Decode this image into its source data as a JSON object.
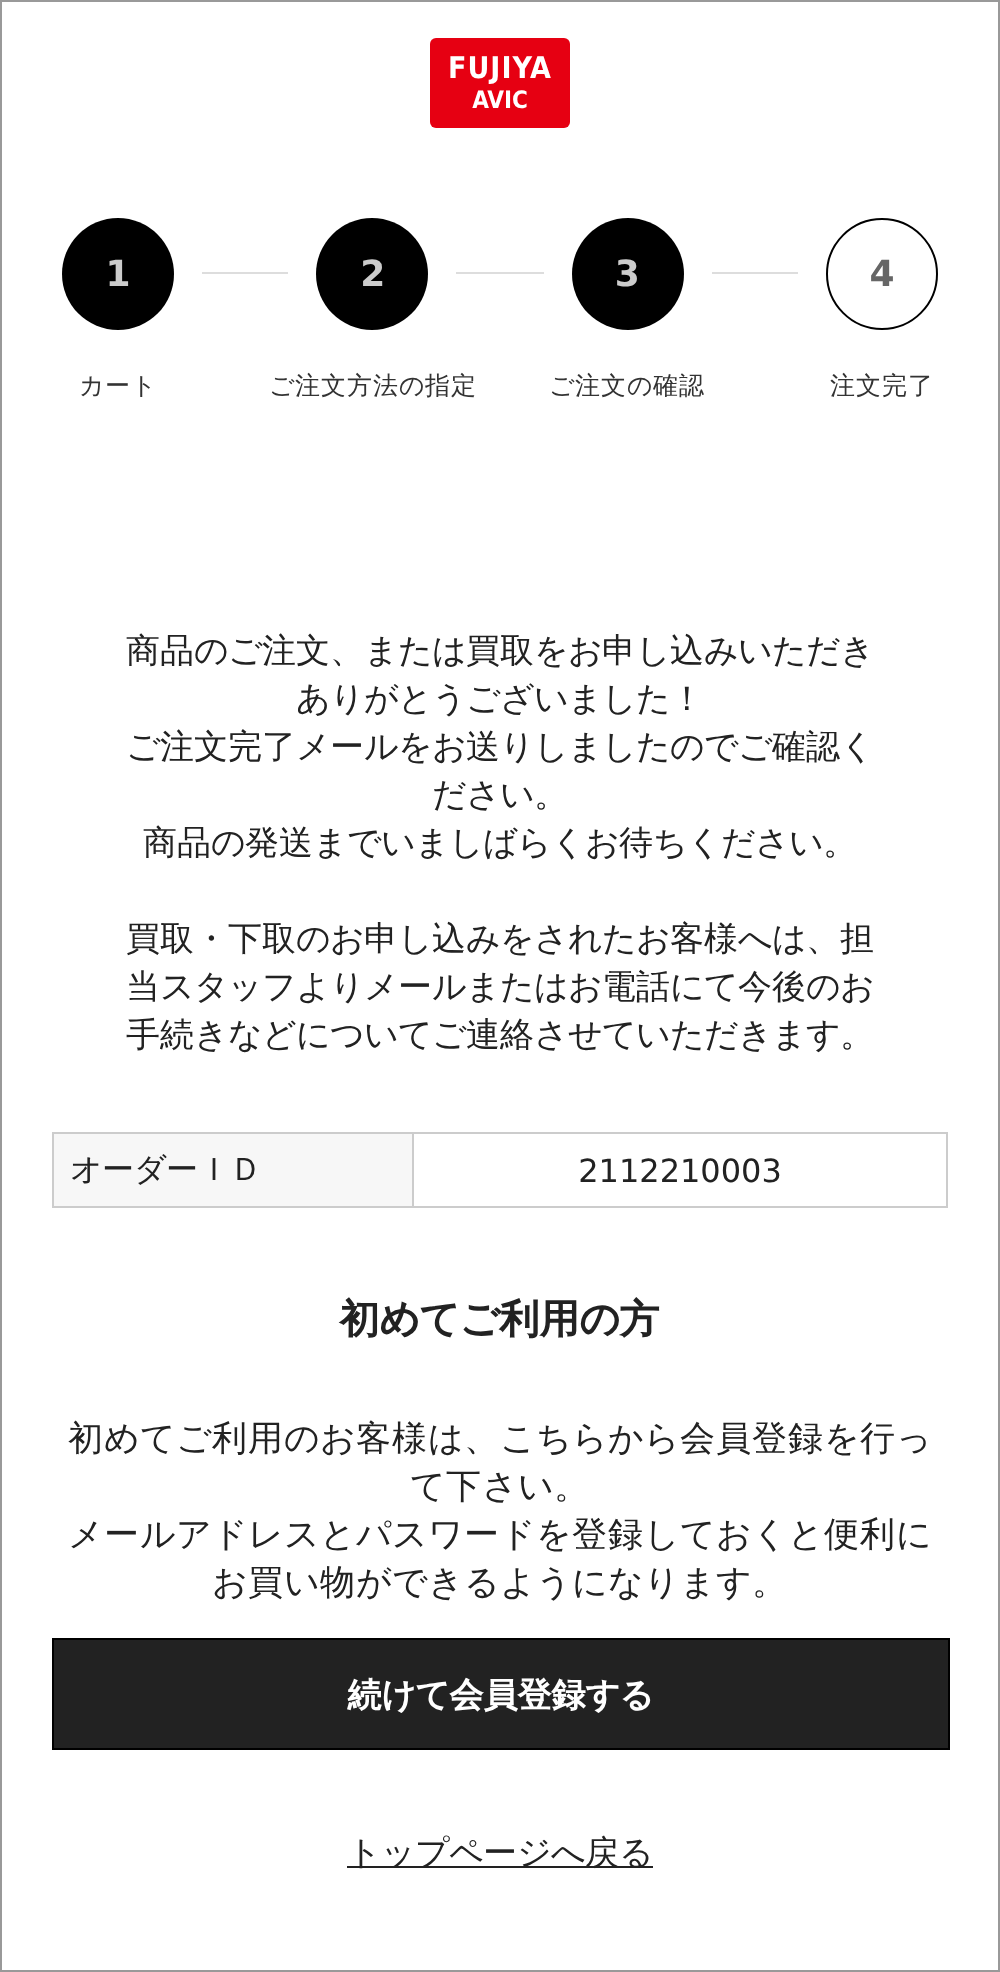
{
  "logo": {
    "lines": [
      "FUJIYA",
      "AVIC"
    ]
  },
  "steps": [
    {
      "number": "1",
      "label": "カート",
      "done": true
    },
    {
      "number": "2",
      "label": "ご注文方法の指定",
      "done": true
    },
    {
      "number": "3",
      "label": "ご注文の確認",
      "done": true
    },
    {
      "number": "4",
      "label": "注文完了",
      "done": false
    }
  ],
  "messages": [
    [
      "商品のご注文、または買取をお申し込みいただきありがとうございました！",
      "ご注文完了メールをお送りしましたのでご確認ください。",
      "商品の発送までいましばらくお待ちください。"
    ],
    [
      "買取・下取のお申し込みをされたお客様へは、担当スタッフよりメールまたはお電話にて今後のお手続きなどについてご連絡させていただきます。"
    ]
  ],
  "order": {
    "label": "オーダーＩＤ",
    "value": "2112210003"
  },
  "first_time": {
    "heading": "初めてご利用の方",
    "lines": [
      "初めてご利用のお客様は、こちらから会員登録を行って下さい。",
      "メールアドレスとパスワードを登録しておくと便利にお買い物ができるようになります。"
    ],
    "button": "続けて会員登録する"
  },
  "top_link": "トップページへ戻る"
}
